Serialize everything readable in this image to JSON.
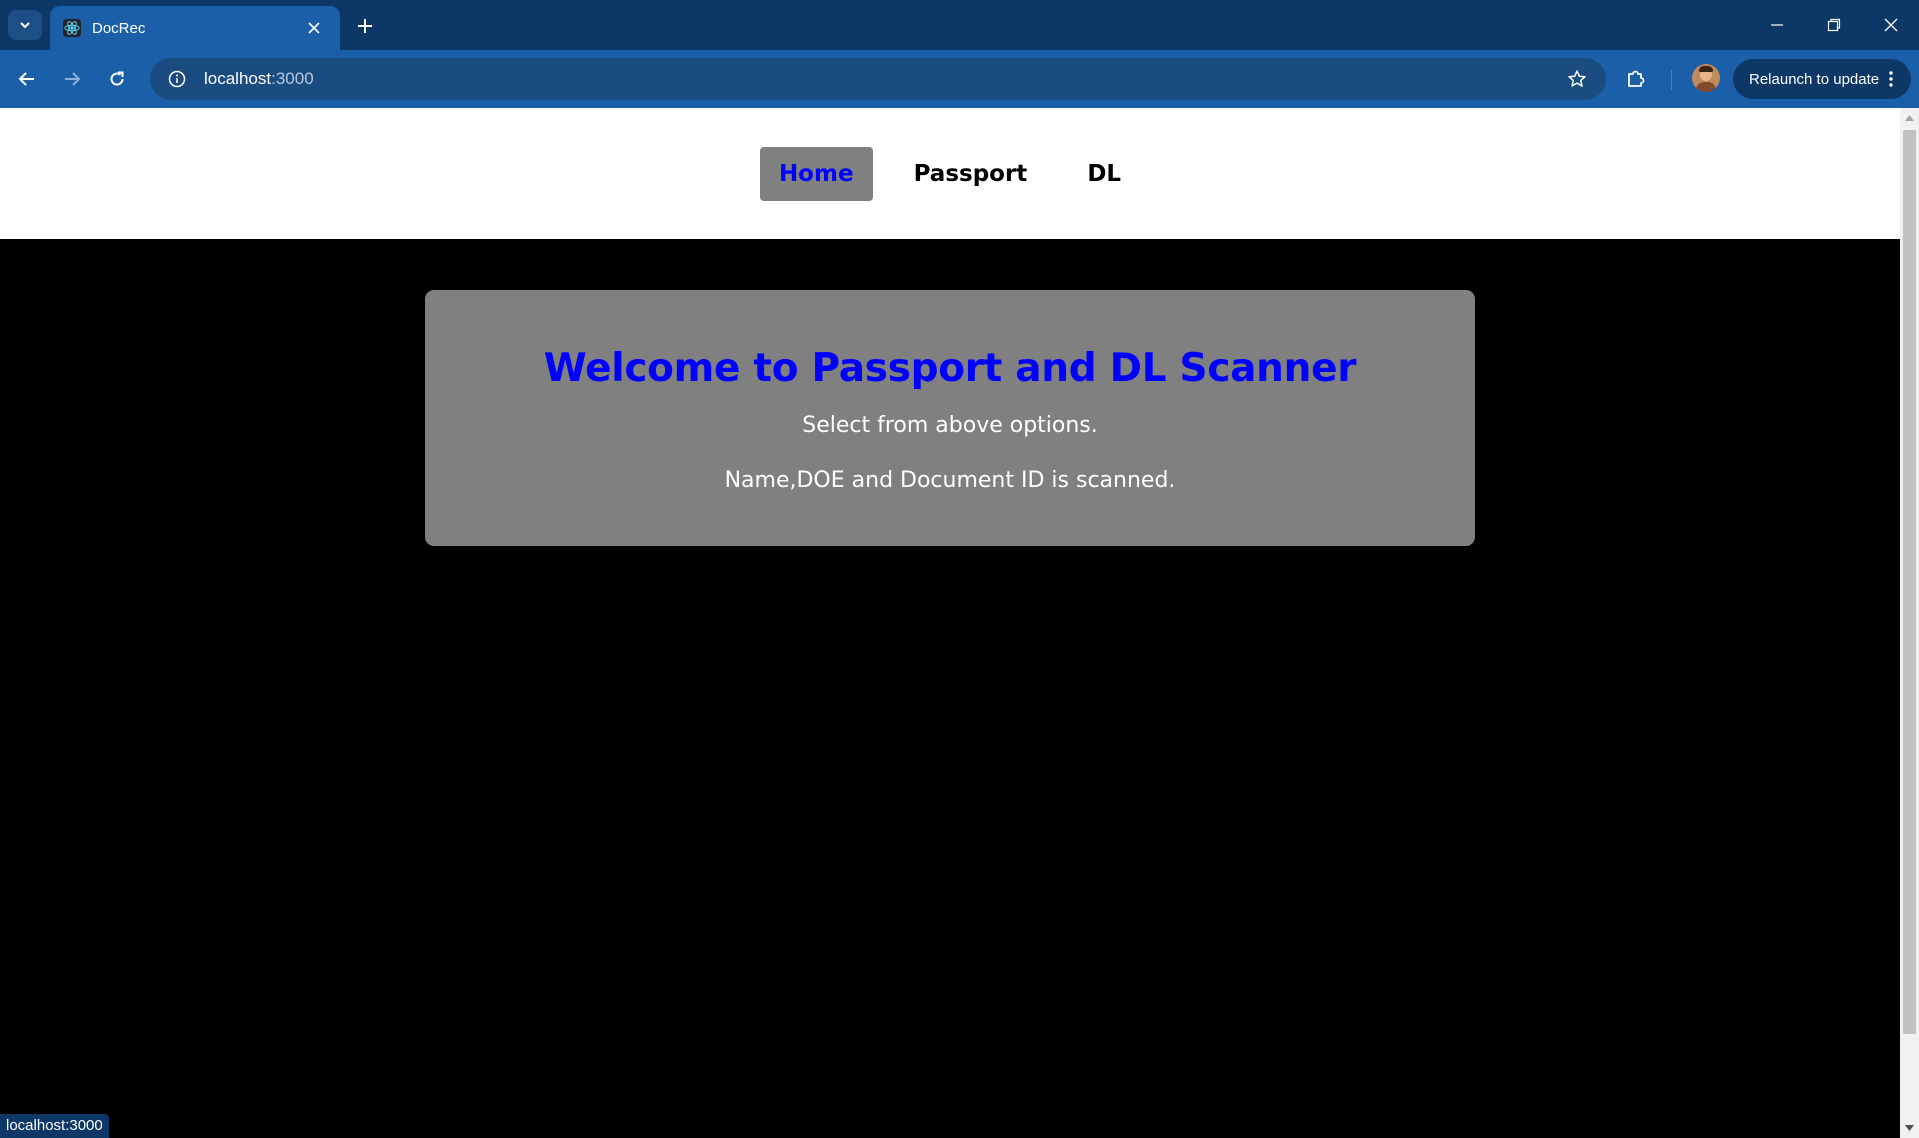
{
  "browser": {
    "tab": {
      "title": "DocRec",
      "favicon": "react-atom-icon"
    },
    "address": {
      "host": "localhost",
      "port": ":3000"
    },
    "relaunch_label": "Relaunch to update",
    "status_url": "localhost:3000",
    "colors": {
      "tabstrip": "#0c3766",
      "toolbar": "#1b5fa8"
    }
  },
  "page": {
    "nav": [
      {
        "label": "Home",
        "active": true
      },
      {
        "label": "Passport",
        "active": false
      },
      {
        "label": "DL",
        "active": false
      }
    ],
    "welcome": {
      "title": "Welcome to Passport and DL Scanner",
      "line1": "Select from above options.",
      "line2": "Name,DOE and Document ID is scanned."
    },
    "colors": {
      "active_link": "#0000ff",
      "card_bg": "#808080",
      "page_bg": "#000000",
      "navbar_bg": "#ffffff"
    }
  }
}
